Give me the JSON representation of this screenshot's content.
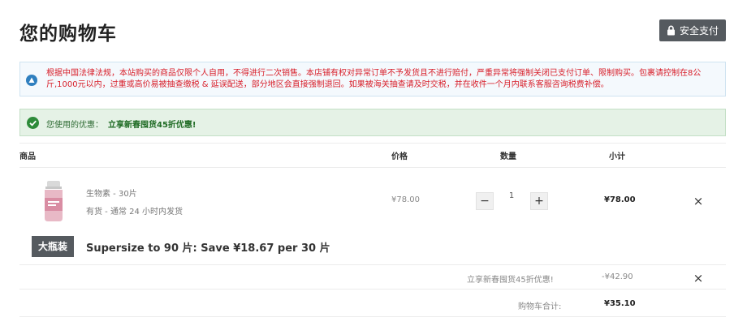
{
  "header": {
    "title": "您的购物车",
    "secure_label": "安全支付"
  },
  "notice": {
    "text": "根据中国法律法规，本站购买的商品仅限个人自用，不得进行二次销售。本店铺有权对异常订单不予发货且不进行赔付，严重异常将强制关闭已支付订单、限制购买。包裹请控制在8公斤,1000元以内，过重或高价易被抽查缴税 & 延误配送，部分地区会直接强制退回。如果被海关抽查请及时交税，并在收件一个月内联系客服咨询税费补偿。"
  },
  "coupon": {
    "label": "您使用的优惠：",
    "name": "立享新春囤货45折优惠!"
  },
  "table": {
    "headers": {
      "product": "商品",
      "price": "价格",
      "qty": "数量",
      "subtotal": "小计"
    }
  },
  "item": {
    "name": "生物素 - 30片",
    "stock": "有货  -  通常 24 小时内发货",
    "price": "¥78.00",
    "qty_minus": "−",
    "qty": "1",
    "qty_plus": "+",
    "subtotal": "¥78.00",
    "remove": "×"
  },
  "upsize": {
    "badge": "大瓶装",
    "text": "Supersize to 90 片: Save ¥18.67 per 30 片"
  },
  "totals": {
    "discount_label": "立享新春囤货45折优惠!",
    "discount_value": "-¥42.90",
    "discount_remove": "×",
    "total_label": "购物车合计:",
    "total_value": "¥35.10"
  },
  "colors": {
    "notice_text": "#d8202b",
    "coupon_text": "#1f6b24",
    "button_dark": "#555a5f"
  },
  "icons": [
    "lock-icon",
    "info-icon",
    "check-circle-icon",
    "close-icon"
  ]
}
